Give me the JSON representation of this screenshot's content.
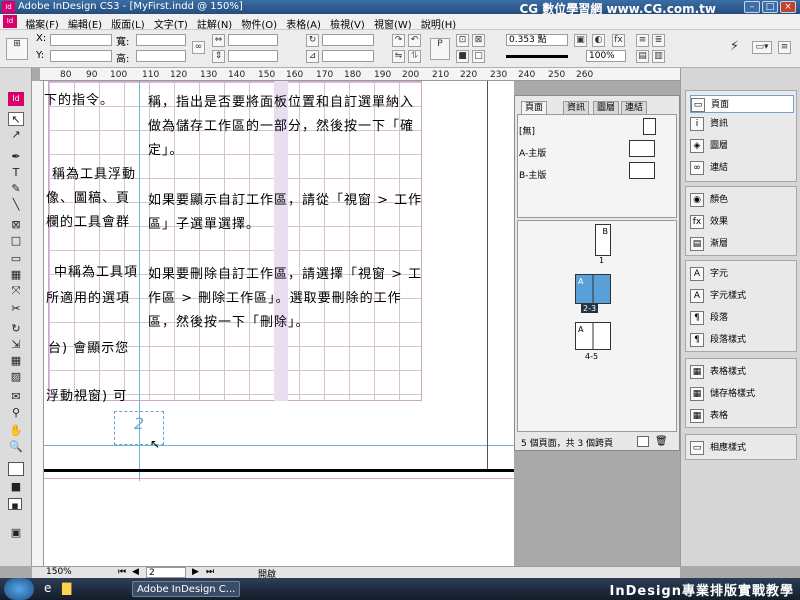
{
  "window": {
    "title": "Adobe InDesign CS3 - [MyFirst.indd @ 150%]",
    "watermark": "CG 數位學習網 www.CG.com.tw",
    "app_icon": "Id"
  },
  "menu": {
    "items": [
      "檔案(F)",
      "編輯(E)",
      "版面(L)",
      "文字(T)",
      "註解(N)",
      "物件(O)",
      "表格(A)",
      "檢視(V)",
      "視窗(W)",
      "說明(H)"
    ]
  },
  "control": {
    "x_label": "X:",
    "y_label": "Y:",
    "w_label": "寬:",
    "h_label": "高:",
    "stroke_value": "0.353 點",
    "zoom_value": "100%"
  },
  "ruler": {
    "ticks": [
      "80",
      "90",
      "100",
      "110",
      "120",
      "130",
      "140",
      "150",
      "160",
      "170",
      "180",
      "190",
      "200",
      "210",
      "220",
      "230",
      "240",
      "250",
      "260"
    ]
  },
  "canvas": {
    "lines": [
      "稱，指出是否要將面板位置和自訂選單納入",
      "做為儲存工作區的一部分，然後按一下「確",
      "定」。",
      "如果要顯示自訂工作區，請從「視窗 > 工作",
      "區」子選單選擇。",
      "如果要刪除自訂工作區，請選擇「視窗 > 工",
      "作區 > 刪除工作區」。選取要刪除的工作",
      "區，然後按一下「刪除」。"
    ],
    "left_lines": [
      "下的指令。",
      "稱為工具浮動",
      "像、圖稿、頁",
      "欄的工具會群",
      "中稱為工具項",
      "所適用的選項",
      "台) 會顯示您",
      "浮動視窗) 可"
    ],
    "page_number": "2"
  },
  "pages_panel": {
    "tabs": [
      "頁面",
      "資訊",
      "圖層",
      "連結"
    ],
    "masters": [
      "[無]",
      "A-主版",
      "B-主版"
    ],
    "spreads": [
      {
        "label": "1",
        "master": "B"
      },
      {
        "label": "2-3",
        "master": "A"
      },
      {
        "label": "4-5",
        "master": "A"
      }
    ],
    "footer": "5 個頁面，共 3 個跨頁"
  },
  "dock": {
    "group1": [
      "頁面",
      "資訊",
      "圖層",
      "連結"
    ],
    "group2": [
      "顏色",
      "效果",
      "漸層"
    ],
    "group3": [
      "字元",
      "字元樣式",
      "段落",
      "段落樣式"
    ],
    "group4": [
      "表格樣式",
      "儲存格樣式",
      "表格"
    ],
    "group5": [
      "相應樣式"
    ]
  },
  "status": {
    "zoom": "150%",
    "page": "2",
    "state": "開啟"
  },
  "taskbar": {
    "app_button": "Adobe InDesign C...",
    "banner": "InDesign專業排版實戰教學"
  },
  "colors": {
    "accent": "#d8006b",
    "grid": "#d7c2d7",
    "title_bar": "#254d7d"
  }
}
